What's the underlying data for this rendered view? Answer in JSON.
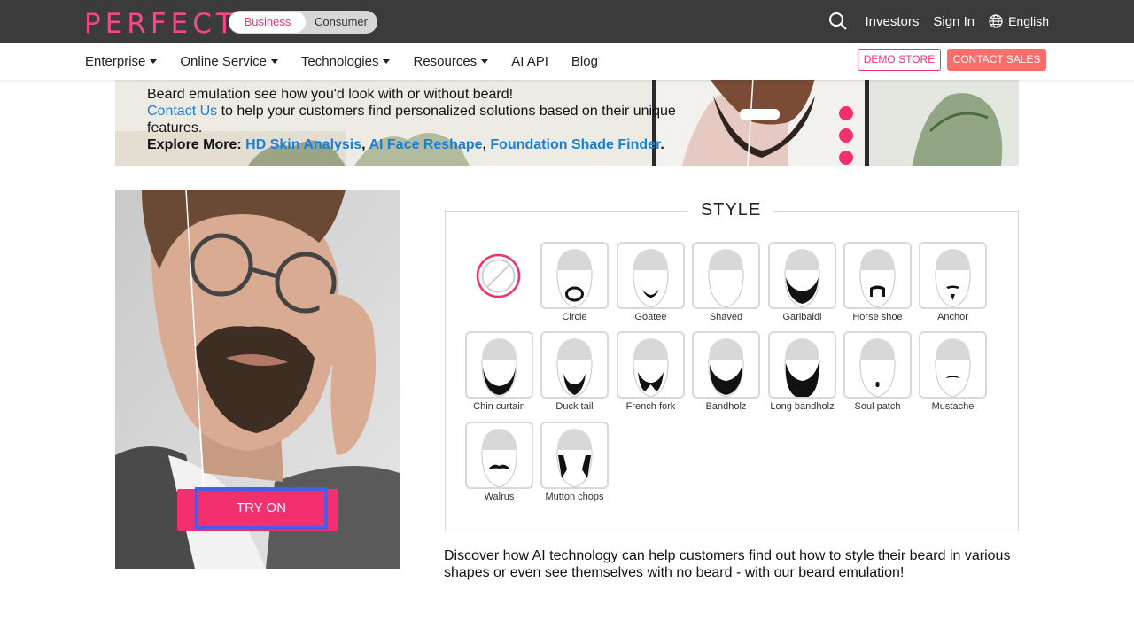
{
  "header": {
    "logo": "PERFECT",
    "toggle": {
      "business": "Business",
      "consumer": "Consumer"
    },
    "links": {
      "investors": "Investors",
      "sign_in": "Sign In",
      "language": "English"
    }
  },
  "nav": {
    "items": [
      {
        "label": "Enterprise",
        "dropdown": true
      },
      {
        "label": "Online Service",
        "dropdown": true
      },
      {
        "label": "Technologies",
        "dropdown": true
      },
      {
        "label": "Resources",
        "dropdown": true
      },
      {
        "label": "AI API",
        "dropdown": false
      },
      {
        "label": "Blog",
        "dropdown": false
      }
    ],
    "demo_store": "DEMO STORE",
    "contact_sales": "CONTACT SALES"
  },
  "banner": {
    "line1": "Beard emulation see how you'd look with or without beard!",
    "contact_link": "Contact Us",
    "line2": " to help your customers find personalized solutions based on their unique features.",
    "explore_label": "Explore More: ",
    "explore_links": [
      "HD Skin Analysis",
      "AI Face Reshape",
      "Foundation Shade Finder"
    ],
    "sep": ", ",
    "end": "."
  },
  "try_on": "TRY ON",
  "style": {
    "title": "STYLE",
    "options": [
      "Circle",
      "Goatee",
      "Shaved",
      "Garibaldi",
      "Horse shoe",
      "Anchor",
      "Chin curtain",
      "Duck tail",
      "French fork",
      "Bandholz",
      "Long bandholz",
      "Soul patch",
      "Mustache",
      "Walrus",
      "Mutton chops"
    ]
  },
  "description": "Discover how AI technology can help customers find out how to style their beard in various shapes or even see themselves with no beard - with our beard emulation!",
  "colors": {
    "brand_pink": "#f2306f",
    "contact_sales": "#fb6d6b",
    "link_blue": "#1a7fd6",
    "topbar": "#3b3b3b",
    "focus_ring": "#4a5de8"
  }
}
